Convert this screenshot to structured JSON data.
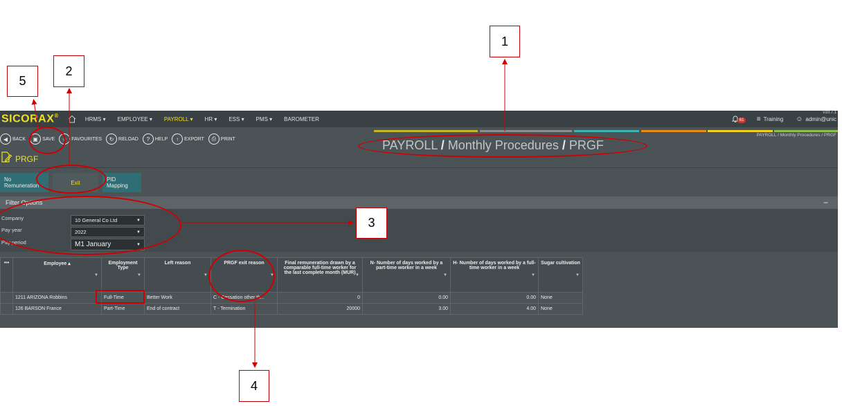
{
  "app": {
    "logo": "SICORAX",
    "logo_mark": "®",
    "version": "v10.7.1",
    "menu": [
      {
        "label": "HRMS ▾",
        "active": false
      },
      {
        "label": "EMPLOYEE ▾",
        "active": false
      },
      {
        "label": "PAYROLL ▾",
        "active": true
      },
      {
        "label": "HR ▾",
        "active": false
      },
      {
        "label": "ESS ▾",
        "active": false
      },
      {
        "label": "PMS ▾",
        "active": false
      },
      {
        "label": "BAROMETER",
        "active": false
      }
    ],
    "notifications": "61",
    "environment": "Training",
    "user": "admin@unic"
  },
  "toolbar": {
    "back": "BACK",
    "save": "SAVE",
    "favourites": "FAVOURITES",
    "reload": "RELOAD",
    "help": "HELP",
    "export": "EXPORT",
    "print": "PRINT"
  },
  "page": {
    "title": "PRGF",
    "breadcrumb_big": [
      "PAYROLL",
      "Monthly Procedures",
      "PRGF"
    ],
    "breadcrumb_sep": "/",
    "breadcrumb_small": "PAYROLL  /  Monthly Procedures  /  PRGF"
  },
  "tabs": [
    "No Remuneration",
    "Exit",
    "PID Mapping"
  ],
  "filter": {
    "title": "Filter Options",
    "collapse": "−",
    "company_label": "Company",
    "company_value": "10 General Co Ltd",
    "pay_year_label": "Pay year",
    "pay_year_value": "2022",
    "pay_period_label": "Pay period",
    "pay_period_value": "M1 January"
  },
  "grid": {
    "menu": "•••",
    "columns": [
      "Employee ▴",
      "Employment Type",
      "Left reason",
      "PRGF exit reason",
      "Final remuneration drawn by a comparable full-time worker for the last complete month (MUR)",
      "N- Number of days worked by a part-time worker in a week",
      "H- Number of days worked by a full-time worker in a week",
      "Sugar cultivation"
    ],
    "rows": [
      [
        "1211 ARIZONA Robbins",
        "Full-Time",
        "Better Work",
        "C - Cessation other th...",
        "0",
        "0.00",
        "0.00",
        "None"
      ],
      [
        "126 BARSON France",
        "Part-Time",
        "End of contract",
        "T - Termination",
        "20000",
        "3.00",
        "4.00",
        "None"
      ]
    ]
  },
  "annotations": {
    "one": "1",
    "two": "2",
    "three": "3",
    "four": "4",
    "five": "5"
  },
  "colors": {
    "accent": "#f0e020",
    "tab_teal": "#2f6e74",
    "annotation": "#d00000"
  }
}
